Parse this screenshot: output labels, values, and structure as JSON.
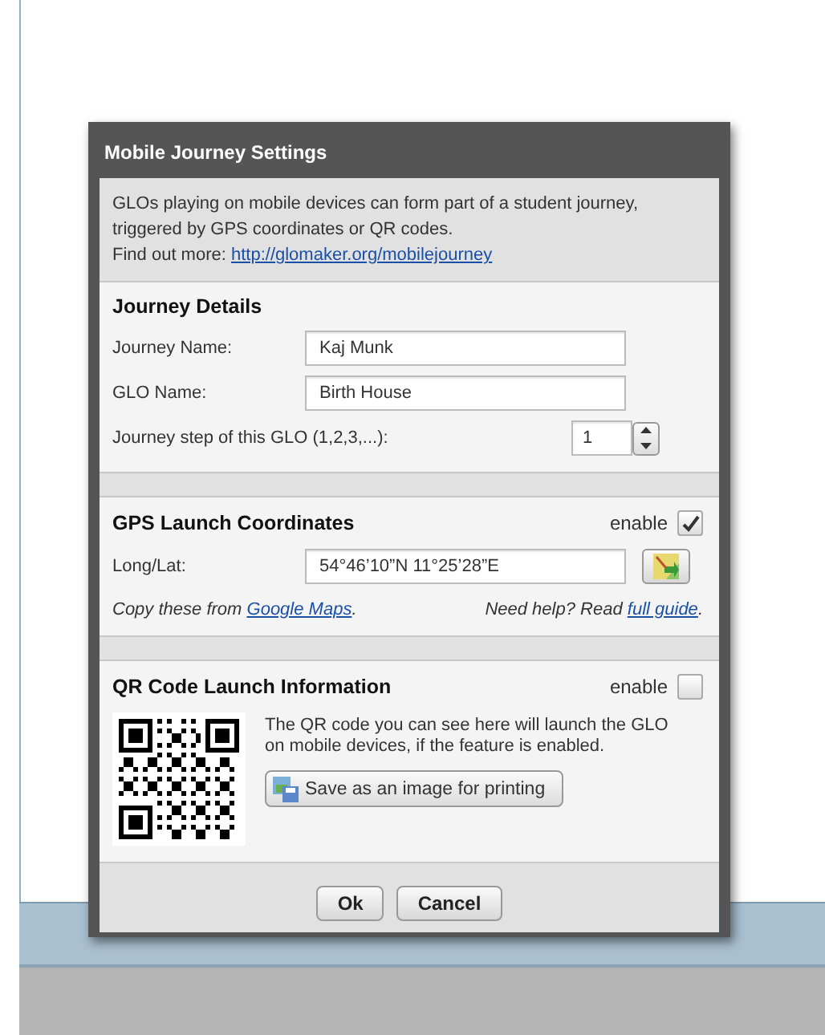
{
  "dialog": {
    "title": "Mobile Journey Settings",
    "intro": {
      "lines": [
        "GLOs playing on mobile devices can form part of a student journey,",
        "triggered by GPS coordinates or QR codes."
      ],
      "more_label": "Find out more:",
      "more_link": "http://glomaker.org/mobilejourney"
    },
    "journey_details": {
      "heading": "Journey Details",
      "fields": [
        {
          "label": "Journey Name:",
          "value": "Kaj Munk"
        },
        {
          "label": "GLO Name:",
          "value": "Birth House"
        }
      ],
      "step": {
        "label": "Journey step of this GLO (1,2,3,...):",
        "value": "1"
      }
    },
    "gps": {
      "heading": "GPS Launch Coordinates",
      "enable_label": "enable",
      "checked": true,
      "field_label": "Long/Lat:",
      "value": "54°46’10”N 11°25’28”E",
      "copy_before": "Copy these from",
      "copy_link": "Google Maps",
      "copy_after": ".",
      "help_before": "Need help? Read",
      "help_link": "full guide",
      "help_after": "."
    },
    "qr": {
      "heading": "QR Code Launch Information",
      "enable_label": "enable",
      "checked": false,
      "description": "The QR code you can see here will launch the GLO on mobile devices, if the feature is enabled.",
      "save_button": "Save as an image for printing"
    },
    "buttons": [
      "Ok",
      "Cancel"
    ]
  }
}
